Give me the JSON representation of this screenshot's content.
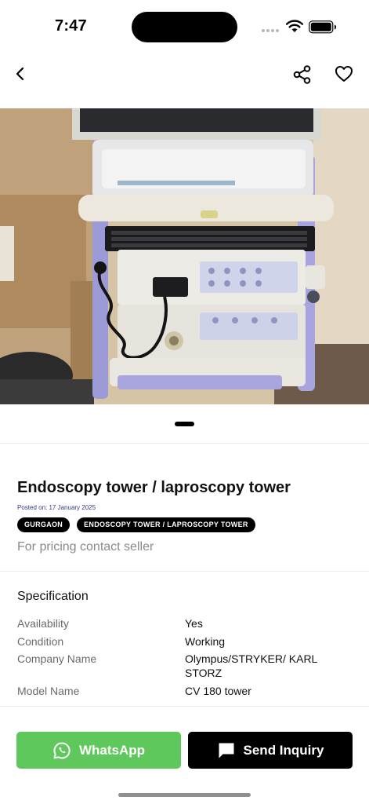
{
  "status_bar": {
    "time": "7:47"
  },
  "nav": {
    "back_icon": "chevron-left-icon",
    "share_icon": "share-icon",
    "favorite_icon": "heart-outline-icon"
  },
  "listing": {
    "title": "Endoscopy tower / laproscopy tower",
    "posted_on": "Posted on: 17 January 2025",
    "tags": [
      "GURGAON",
      "ENDOSCOPY TOWER / LAPROSCOPY TOWER"
    ],
    "price_note": "For pricing contact seller"
  },
  "specification": {
    "heading": "Specification",
    "rows": [
      {
        "key": "Availability",
        "value": "Yes"
      },
      {
        "key": "Condition",
        "value": "Working"
      },
      {
        "key": "Company Name",
        "value": "Olympus/STRYKER/ KARL STORZ"
      },
      {
        "key": "Model Name",
        "value": "CV 180 tower"
      }
    ]
  },
  "actions": {
    "whatsapp_label": "WhatsApp",
    "inquiry_label": "Send Inquiry"
  },
  "colors": {
    "whatsapp_green": "#5fc85c",
    "inquiry_black": "#000000",
    "posted_text": "#2f3b8a",
    "muted_text": "#8a8a8a"
  }
}
